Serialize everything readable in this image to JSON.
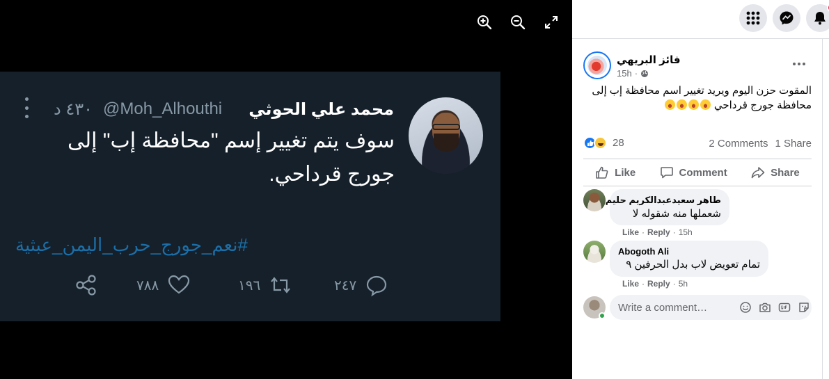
{
  "viewer": {
    "controls": [
      "zoom-in",
      "zoom-out",
      "fullscreen"
    ],
    "tweet": {
      "name": "محمد علي الحوثي",
      "handle": "@Moh_Alhouthi",
      "time": "٤٣٠ د",
      "text_line1": "سوف يتم تغيير إسم \"محافظة إب\" إلى",
      "text_line2": "جورج قرداحي.",
      "hashtag": "#نعم_جورج_حرب_اليمن_عبثية",
      "likes": "٧٨٨",
      "retweets": "١٩٦",
      "replies": "٢٤٧"
    }
  },
  "topbar": {
    "icons": [
      "menu-grid-icon",
      "messenger-icon",
      "bell-icon"
    ]
  },
  "post": {
    "author": "فائز البريهي",
    "time": "15h",
    "audience_icon": "globe-icon",
    "text": "المقوت حزن اليوم ويريد تغيير اسم محافظة إب إلى محافظة جورج قرداحي",
    "reactions_count": "28",
    "comments_count": "2 Comments",
    "shares_count": "1 Share",
    "actions": {
      "like": "Like",
      "comment": "Comment",
      "share": "Share"
    }
  },
  "comments": [
    {
      "name": "طاهر سعيدعبدالكريم حليم",
      "text": "شعملها منه شقوله لا",
      "like": "Like",
      "reply": "Reply",
      "time": "15h"
    },
    {
      "name": "Abogoth Ali",
      "text": "تمام تعويض لاب بدل الحرفين ٩",
      "like": "Like",
      "reply": "Reply",
      "time": "5h"
    }
  ],
  "composer": {
    "placeholder": "Write a comment…"
  },
  "colors": {
    "accent": "#1877f2",
    "tweet_bg": "#15202b",
    "hashtag": "#1b6fa8"
  }
}
